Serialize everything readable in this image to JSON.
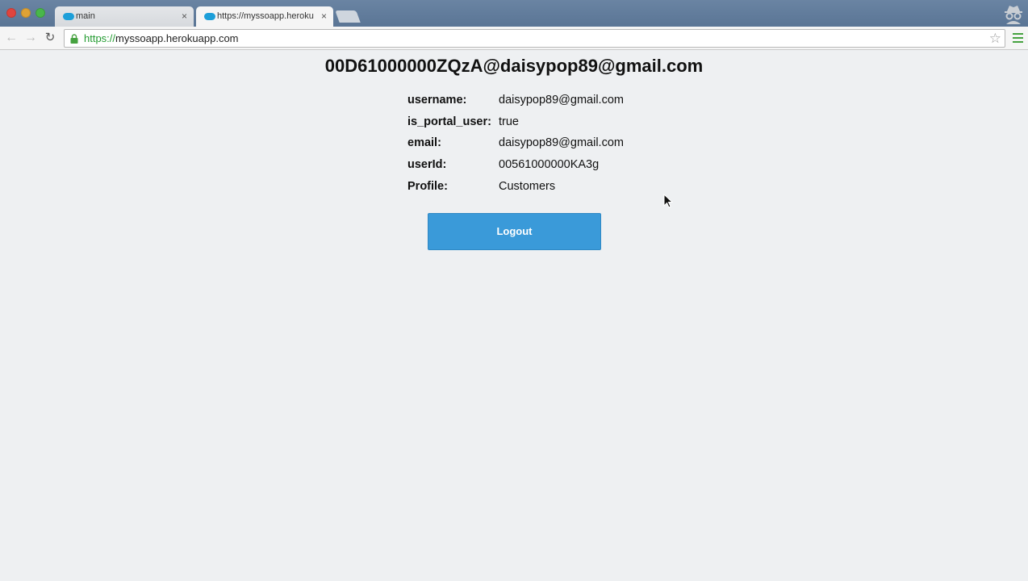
{
  "browser": {
    "tabs": [
      {
        "label": "main",
        "close": "×"
      },
      {
        "label": "https://myssoapp.herokuapp.com",
        "close": "×"
      }
    ],
    "url_scheme": "https://",
    "url_host": "myssoapp.herokuapp.com"
  },
  "page": {
    "title": "00D61000000ZQzA@daisypop89@gmail.com",
    "fields": [
      {
        "key": "username:",
        "value": "daisypop89@gmail.com"
      },
      {
        "key": "is_portal_user:",
        "value": "true"
      },
      {
        "key": "email:",
        "value": "daisypop89@gmail.com"
      },
      {
        "key": "userId:",
        "value": "00561000000KA3g"
      },
      {
        "key": "Profile:",
        "value": "Customers"
      }
    ],
    "logout_label": "Logout"
  },
  "colors": {
    "button": "#3a9ad9",
    "background": "#eef0f2",
    "secure_green": "#239b31"
  }
}
